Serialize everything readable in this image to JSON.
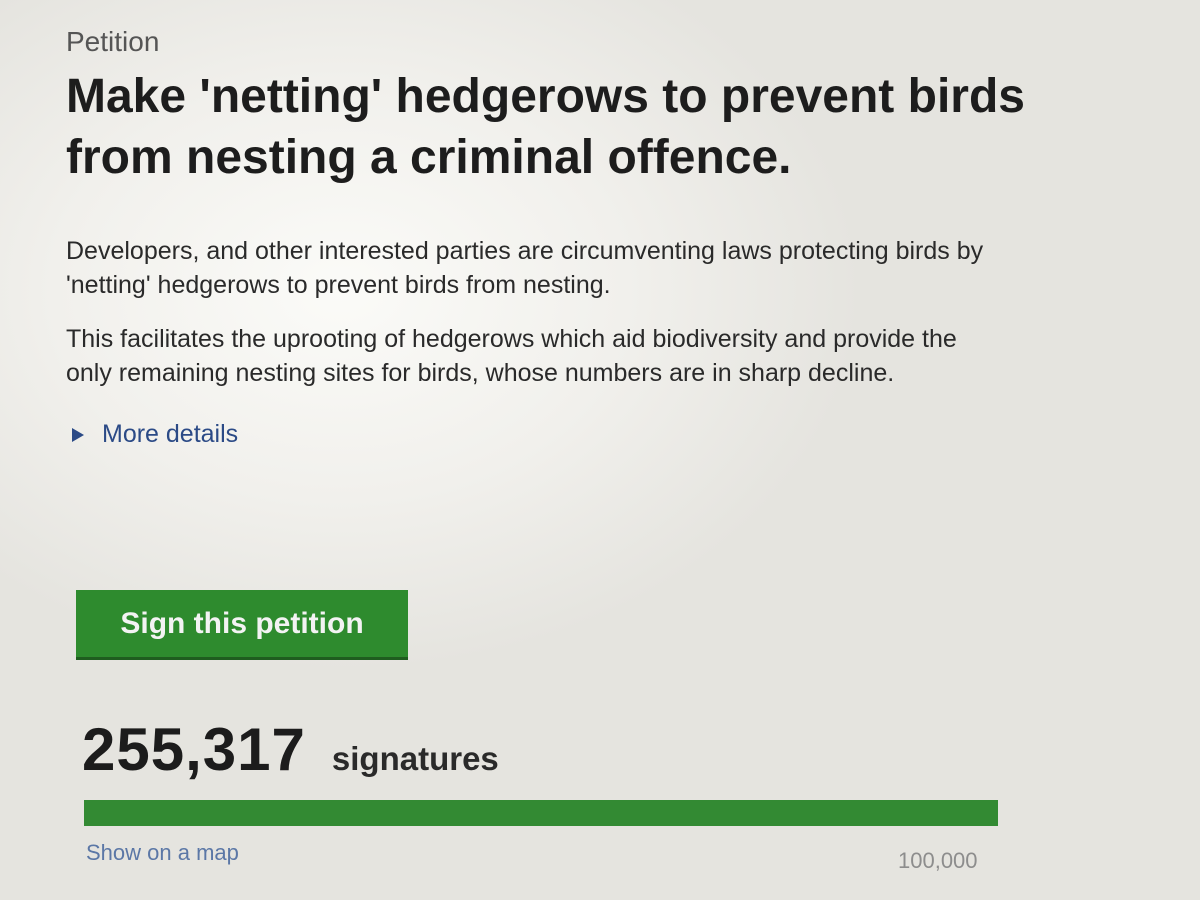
{
  "petition": {
    "eyebrow": "Petition",
    "title": "Make 'netting' hedgerows to prevent birds from nesting a criminal offence.",
    "description": [
      "Developers, and other interested parties are circumventing laws protecting birds by 'netting' hedgerows to prevent birds from nesting.",
      "This facilitates the uprooting of hedgerows which aid biodiversity and provide the only remaining nesting sites for birds, whose numbers are in sharp decline."
    ],
    "more_details_label": "More details",
    "sign_button_label": "Sign this petition"
  },
  "signatures": {
    "count": "255,317",
    "label": "signatures",
    "progress_percent": 100,
    "show_map_label": "Show on a map",
    "target": "100,000"
  },
  "colors": {
    "accent_green": "#2e8b2e",
    "link_blue": "#2b4a86"
  },
  "icons": {
    "details_toggle": "triangle-right-icon"
  }
}
